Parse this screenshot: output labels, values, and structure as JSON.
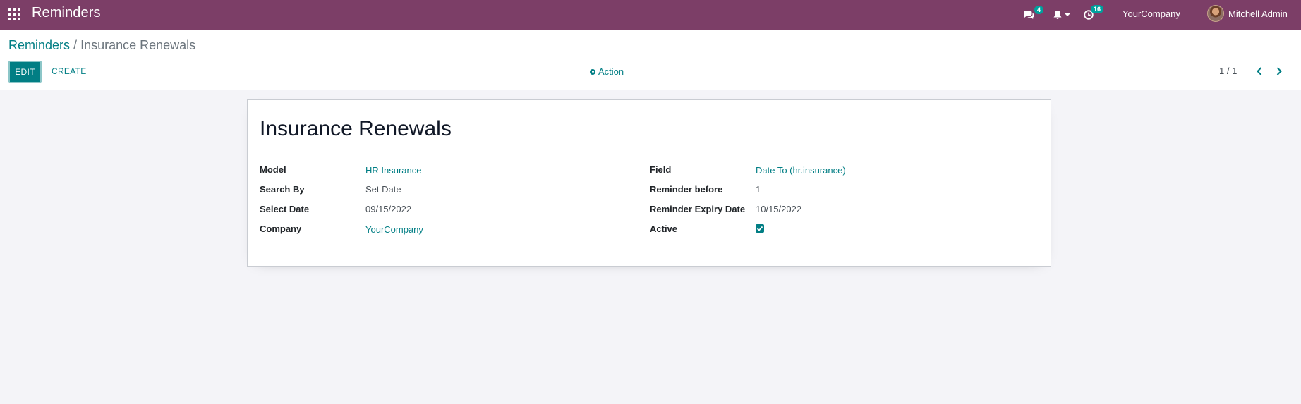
{
  "navbar": {
    "app_name": "Reminders",
    "apps_icon": "apps-grid-icon",
    "messages": {
      "icon": "chat-bubbles-icon",
      "count": "4"
    },
    "notifications": {
      "icon": "bell-icon"
    },
    "activities": {
      "icon": "clock-icon",
      "count": "16"
    },
    "company": "YourCompany",
    "user": "Mitchell Admin"
  },
  "breadcrumb": {
    "parent": "Reminders",
    "separator": "/",
    "current": "Insurance Renewals"
  },
  "toolbar": {
    "edit_label": "EDIT",
    "create_label": "CREATE",
    "action_label": "Action",
    "action_icon": "gear-icon"
  },
  "pager": {
    "value": "1 / 1",
    "prev_icon": "chevron-left-icon",
    "next_icon": "chevron-right-icon"
  },
  "record": {
    "title": "Insurance Renewals",
    "left_fields": [
      {
        "label": "Model",
        "value": "HR Insurance"
      },
      {
        "label": "Search By",
        "value": "Set Date"
      },
      {
        "label": "Select Date",
        "value": "09/15/2022"
      },
      {
        "label": "Company",
        "value": "YourCompany"
      }
    ],
    "right_fields": [
      {
        "label": "Field",
        "value": "Date To (hr.insurance)"
      },
      {
        "label": "Reminder before",
        "value": "1"
      },
      {
        "label": "Reminder Expiry Date",
        "value": "10/15/2022"
      },
      {
        "label": "Active",
        "checked": true
      }
    ]
  },
  "colors": {
    "navbar": "#7c3e67",
    "accent": "#017e84",
    "background": "#f4f4f8"
  }
}
